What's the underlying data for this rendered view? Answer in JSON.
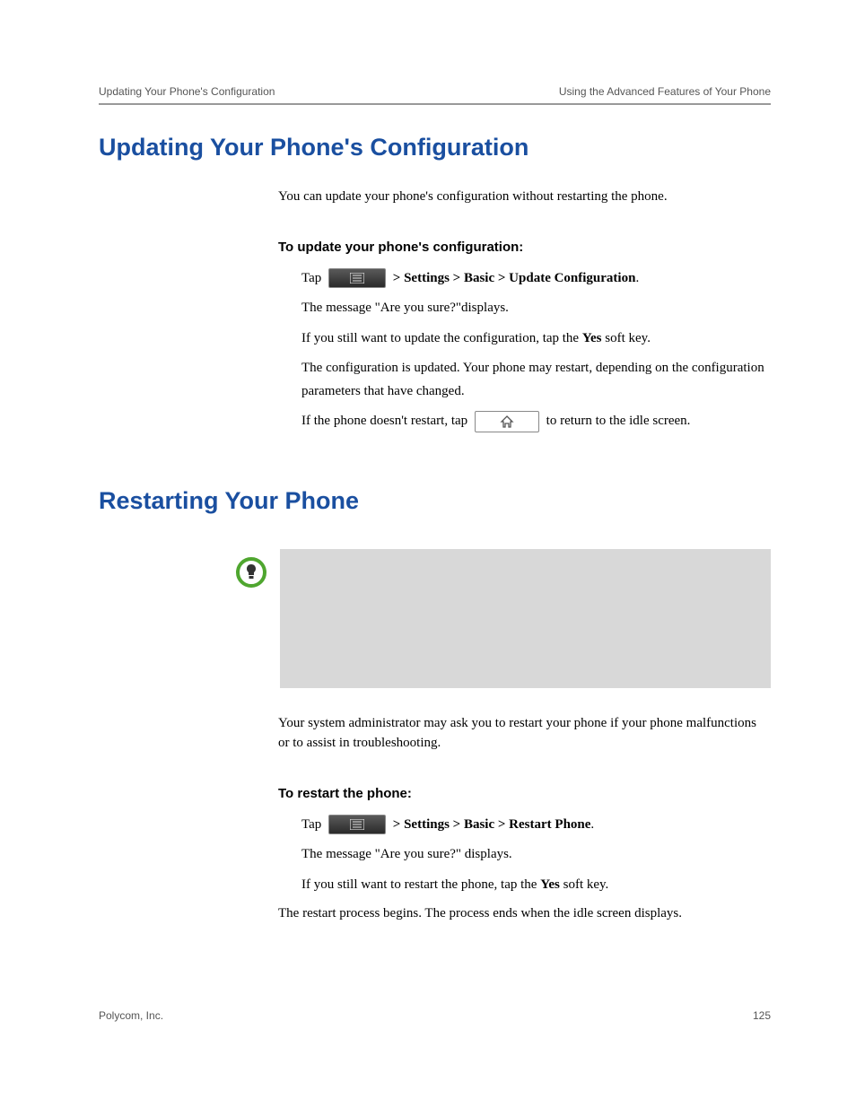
{
  "header": {
    "left": "Updating Your Phone's Configuration",
    "right": "Using the Advanced Features of Your Phone"
  },
  "section1": {
    "title": "Updating Your Phone's Configuration",
    "intro": "You can update your phone's configuration without restarting the phone.",
    "proc_heading": "To update your phone's configuration:",
    "step1_prefix": "Tap",
    "step1_path": " > Settings > Basic > Update Configuration",
    "step1_suffix": ".",
    "step2": "The message \"Are you sure?\"displays.",
    "step3_prefix": "If you still want to update the configuration, tap the ",
    "step3_bold": "Yes",
    "step3_suffix": " soft key.",
    "step4": "The configuration is updated. Your phone may restart, depending on the configuration parameters that have changed.",
    "step5_prefix": "If the phone doesn't restart, tap ",
    "step5_suffix": " to return to the idle screen."
  },
  "section2": {
    "title": "Restarting Your Phone",
    "intro": "Your system administrator may ask you to restart your phone if your phone malfunctions or to assist in troubleshooting.",
    "proc_heading": "To restart the phone:",
    "step1_prefix": "Tap",
    "step1_path": " > Settings > Basic > Restart Phone",
    "step1_suffix": ".",
    "step2": "The message \"Are you sure?\" displays.",
    "step3_prefix": "If you still want to restart the phone, tap the ",
    "step3_bold": "Yes",
    "step3_suffix": " soft key.",
    "step4": "The restart process begins. The process ends when the idle screen displays."
  },
  "footer": {
    "company": "Polycom, Inc.",
    "page": "125"
  }
}
